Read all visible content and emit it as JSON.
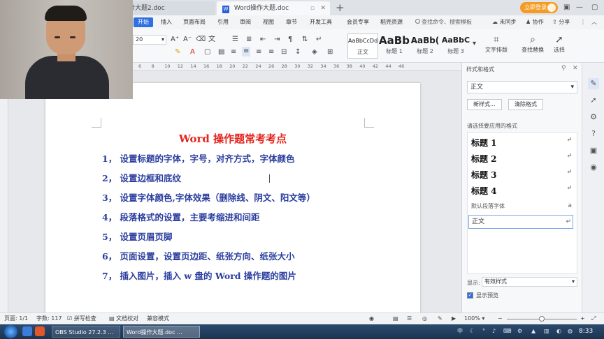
{
  "tabs": {
    "doc2": "考大题2.doc",
    "main": "Word操作大题.doc",
    "main_glyph": "W"
  },
  "topbar": {
    "login": "立即登录"
  },
  "menu": {
    "items": [
      "开始",
      "插入",
      "页面布局",
      "引用",
      "审阅",
      "视图",
      "章节",
      "开发工具",
      "会员专享",
      "稻壳资源"
    ],
    "search": "查找命令、搜索模板",
    "sync": "未同步",
    "collab": "协作",
    "share": "分享"
  },
  "toolbar": {
    "font_size": "20",
    "styles": [
      {
        "preview": "AaBbCcDd",
        "name": "正文"
      },
      {
        "preview": "AaBb",
        "name": "标题 1"
      },
      {
        "preview": "AaBb(",
        "name": "标题 2"
      },
      {
        "preview": "AaBbC",
        "name": "标题 3"
      }
    ],
    "text_layout": "文字排版",
    "find_replace": "查找替换",
    "select": "选择"
  },
  "ruler": {
    "numbers": [
      "6",
      "8",
      "10",
      "12",
      "14",
      "16",
      "18",
      "20",
      "22",
      "24",
      "26",
      "28",
      "30",
      "32",
      "34",
      "36",
      "38",
      "40",
      "42",
      "44",
      "46"
    ]
  },
  "document": {
    "title": "Word 操作题常考考点",
    "lines": [
      "1， 设置标题的字体，字号，对齐方式，字体颜色",
      "2， 设置边框和底纹",
      "3， 设置字体颜色,字体效果（删除线、阴文、阳文等）",
      "4， 段落格式的设置，主要考缩进和间距",
      "5， 设置页眉页脚",
      "6， 页面设置，设置页边距、纸张方向、纸张大小",
      "7， 插入图片，插入 w 盘的 Word 操作题的图片"
    ]
  },
  "panel": {
    "title": "样式和格式",
    "current_style": "正文",
    "new_style": "新样式...",
    "clear_format": "清除格式",
    "apply_label": "请选择要应用的格式",
    "styles": [
      "标题 1",
      "标题 2",
      "标题 3",
      "标题 4"
    ],
    "default_font": "默认段落字体",
    "normal": "正文",
    "show_label": "显示:",
    "show_value": "有效样式",
    "preview_label": "显示预览"
  },
  "status": {
    "page": "页面: 1/1",
    "words": "字数: 117",
    "spell": "拼写检查",
    "proof": "文档校对",
    "compat": "兼容模式",
    "zoom": "100%",
    "zoom_level": 0.5
  },
  "taskbar": {
    "obs": "OBS Studio 27.2.3 ...",
    "wps": "Word操作大题.doc ...",
    "time": "8:33"
  },
  "colors": {
    "title_red": "#e3261f",
    "body_blue": "#2a3d9e",
    "accent_blue": "#2f6fe0",
    "login_orange": "#f39b22"
  }
}
